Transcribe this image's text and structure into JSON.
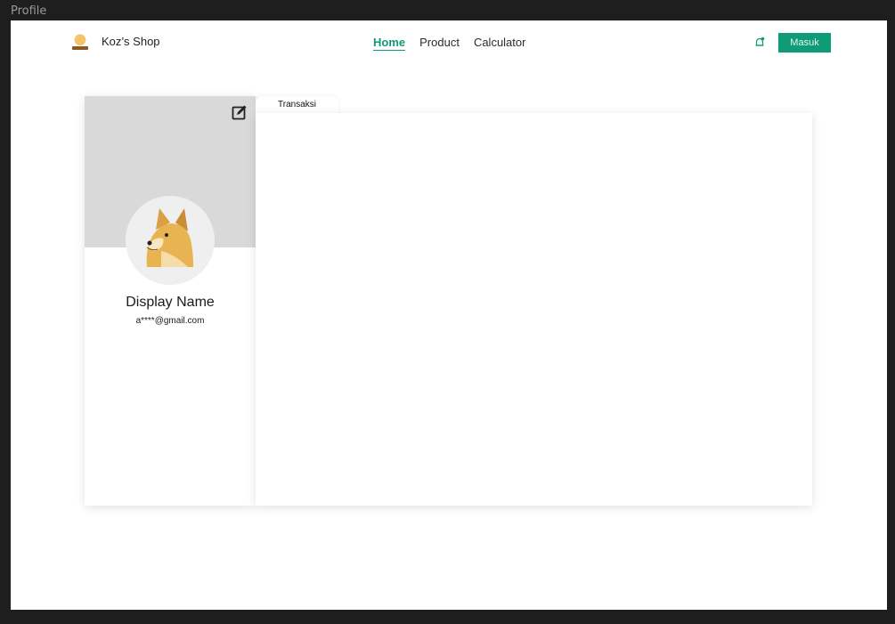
{
  "frame": {
    "label": "Profile"
  },
  "navbar": {
    "brand": {
      "name": "Koz’s Shop",
      "logo_icon": "shop-logo-icon"
    },
    "links": [
      {
        "label": "Home",
        "active": true
      },
      {
        "label": "Product",
        "active": false
      },
      {
        "label": "Calculator",
        "active": false
      }
    ],
    "notification_icon": "bell-icon",
    "login_button": "Masuk"
  },
  "profile": {
    "edit_icon": "edit-icon",
    "avatar_icon": "doge-avatar",
    "display_name": "Display Name",
    "email": "a****@gmail.com"
  },
  "tabs": [
    {
      "label": "Transaksi"
    }
  ],
  "colors": {
    "accent": "#0f9a78",
    "cover": "#d9d9d9",
    "background": "#1e1e1e"
  }
}
